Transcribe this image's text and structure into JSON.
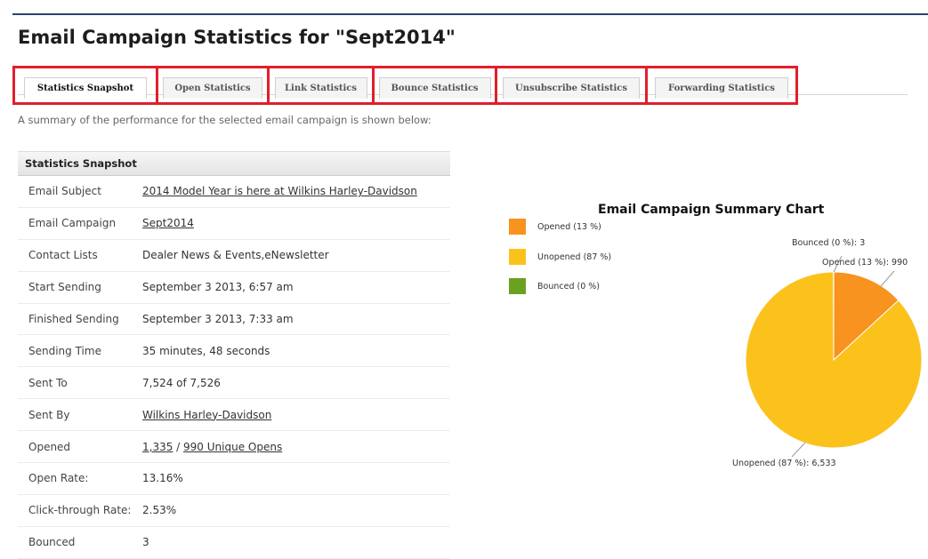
{
  "page": {
    "title": "Email Campaign Statistics for \"Sept2014\"",
    "summary": "A summary of the performance for the selected email campaign is shown below:"
  },
  "tabs": [
    {
      "label": "Statistics Snapshot",
      "active": true
    },
    {
      "label": "Open Statistics",
      "active": false
    },
    {
      "label": "Link Statistics",
      "active": false
    },
    {
      "label": "Bounce Statistics",
      "active": false
    },
    {
      "label": "Unsubscribe Statistics",
      "active": false
    },
    {
      "label": "Forwarding Statistics",
      "active": false
    }
  ],
  "stats": {
    "header": "Statistics Snapshot",
    "rows": [
      {
        "label": "Email Subject",
        "value": "2014 Model Year is here at Wilkins Harley-Davidson"
      },
      {
        "label": "Email Campaign",
        "value": "Sept2014"
      },
      {
        "label": "Contact Lists",
        "value": "Dealer News & Events,eNewsletter"
      },
      {
        "label": "Start Sending",
        "value": "September 3 2013, 6:57 am"
      },
      {
        "label": "Finished Sending",
        "value": "September 3 2013, 7:33 am"
      },
      {
        "label": "Sending Time",
        "value": "35 minutes, 48 seconds"
      },
      {
        "label": "Sent To",
        "value": "7,524 of 7,526"
      },
      {
        "label": "Sent By",
        "value": "Wilkins Harley-Davidson"
      },
      {
        "label": "Opened",
        "value_total": "1,335",
        "value_sep": " / ",
        "value_unique": "990 Unique Opens"
      },
      {
        "label": "Open Rate:",
        "value": "13.16%"
      },
      {
        "label": "Click-through Rate:",
        "value": "2.53%"
      },
      {
        "label": "Bounced",
        "value": "3"
      }
    ]
  },
  "chart": {
    "title": "Email Campaign Summary Chart",
    "colors": {
      "opened": "#f7931e",
      "unopened": "#fcc21c",
      "bounced": "#6aa121"
    },
    "legend": [
      "Opened (13 %)",
      "Unopened (87 %)",
      "Bounced (0 %)"
    ],
    "labels": {
      "bounced": "Bounced (0 %): 3",
      "opened": "Opened (13 %): 990",
      "unopened": "Unopened (87 %): 6,533"
    }
  },
  "chart_data": {
    "type": "pie",
    "title": "Email Campaign Summary Chart",
    "categories": [
      "Opened",
      "Unopened",
      "Bounced"
    ],
    "values": [
      990,
      6533,
      3
    ],
    "percent": [
      13,
      87,
      0
    ],
    "legend": "left"
  }
}
